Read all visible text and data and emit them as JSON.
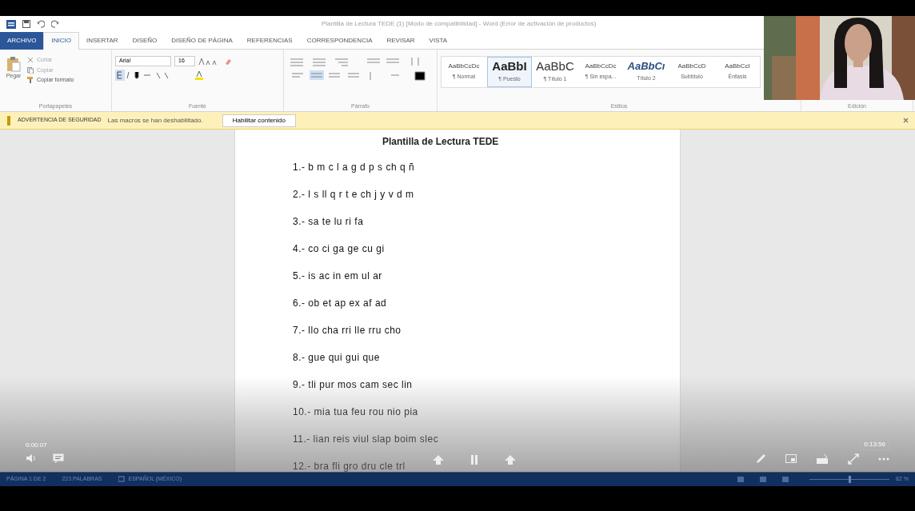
{
  "window": {
    "title": "Plantilla de Lectura TEDE (1) [Modo de compatibilidad] - Word (Error de activación de productos)"
  },
  "ribbon_tabs": [
    {
      "label": "ARCHIVO",
      "kind": "file",
      "selected": false
    },
    {
      "label": "INICIO",
      "kind": "tab",
      "selected": true
    },
    {
      "label": "INSERTAR",
      "kind": "tab",
      "selected": false
    },
    {
      "label": "DISEÑO",
      "kind": "tab",
      "selected": false
    },
    {
      "label": "DISEÑO DE PÁGINA",
      "kind": "tab",
      "selected": false
    },
    {
      "label": "REFERENCIAS",
      "kind": "tab",
      "selected": false
    },
    {
      "label": "CORRESPONDENCIA",
      "kind": "tab",
      "selected": false
    },
    {
      "label": "REVISAR",
      "kind": "tab",
      "selected": false
    },
    {
      "label": "VISTA",
      "kind": "tab",
      "selected": false
    }
  ],
  "clipboard": {
    "paste": "Pegar",
    "cut": "Cortar",
    "copy": "Copiar",
    "format_painter": "Copiar formato",
    "group": "Portapapeles"
  },
  "font": {
    "name": "Arial",
    "size": "16",
    "group": "Fuente"
  },
  "paragraph": {
    "group": "Párrafo"
  },
  "styles": {
    "group": "Estilos",
    "items": [
      {
        "sample": "AaBbCcDc",
        "label": "¶ Normal",
        "kind": "small",
        "selected": false
      },
      {
        "sample": "AaBbI",
        "label": "¶ Puesto",
        "kind": "big",
        "selected": true
      },
      {
        "sample": "AaBbC",
        "label": "¶ Título 1",
        "kind": "big",
        "selected": false
      },
      {
        "sample": "AaBbCcDc",
        "label": "¶ Sin espa...",
        "kind": "small",
        "selected": false
      },
      {
        "sample": "AaBbCı",
        "label": "Título 2",
        "kind": "italic",
        "selected": false
      },
      {
        "sample": "AaBbCcD",
        "label": "Subtítulo",
        "kind": "small",
        "selected": false
      },
      {
        "sample": "AaBbCcI",
        "label": "Énfasis",
        "kind": "small",
        "selected": false
      }
    ]
  },
  "editing": {
    "group": "Edición"
  },
  "security_bar": {
    "title": "ADVERTENCIA DE SEGURIDAD",
    "message": "Las macros se han deshabilitado.",
    "button": "Habilitar contenido"
  },
  "document": {
    "heading": "Plantilla de Lectura TEDE",
    "lines": [
      "1.- b m c l a g d p s ch q ñ",
      "2.- l s ll q r t e ch j y v d m",
      "3.- sa te lu ri fa",
      "4.- co ci ga ge cu gi",
      "5.- is ac in em ul ar",
      "6.- ob et ap ex af ad",
      "7.- llo cha rri lle rru cho",
      "8.- gue qui gui que",
      "9.- tli pur mos cam sec lin",
      "10.- mia tua feu rou nio pia",
      "11.- lian reis viul slap boim slec",
      "12.- bra fli gro dru cle trl"
    ]
  },
  "status_bar": {
    "page": "PÁGINA 1 DE 2",
    "words": "223 PALABRAS",
    "language": "ESPAÑOL (MÉXICO)",
    "zoom": "82 %",
    "zoom_slider": {
      "level": 0.5
    }
  },
  "player": {
    "elapsed": "0:00:07",
    "duration": "0:13:56"
  }
}
